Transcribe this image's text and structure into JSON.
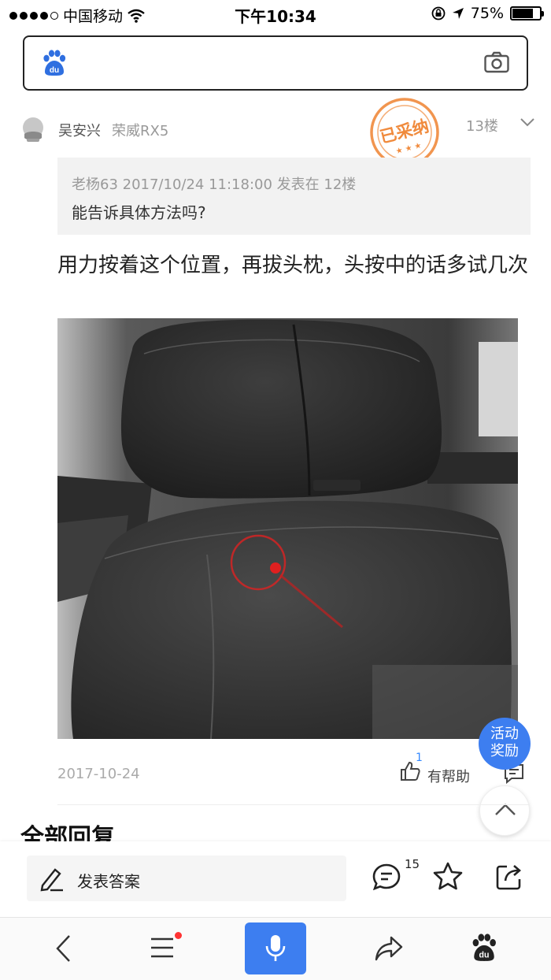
{
  "status_bar": {
    "carrier": "中国移动",
    "time": "下午10:34",
    "battery": "75%",
    "battery_level": 0.75
  },
  "search": {
    "logo_text": "du"
  },
  "post": {
    "username": "吴安兴",
    "user_tag": "荣威RX5",
    "stamp_text": "已采纳",
    "floor": "13楼",
    "quote_meta": "老杨63  2017/10/24 11:18:00 发表在 12楼",
    "quote_text": "能告诉具体方法吗?",
    "body": "用力按着这个位置，再拔头枕，头按中的话多试几次",
    "date": "2017-10-24",
    "helpful_count": "1",
    "helpful_label": "有帮助"
  },
  "floating": {
    "activity_line1": "活动",
    "activity_line2": "奖励"
  },
  "section": {
    "all_replies": "全部回复"
  },
  "action_bar": {
    "answer_label": "发表答案",
    "reply_count": "15"
  },
  "colors": {
    "accent": "#3d7ef0",
    "stamp": "#f08a3c",
    "notification_dot": "#ff3333"
  }
}
